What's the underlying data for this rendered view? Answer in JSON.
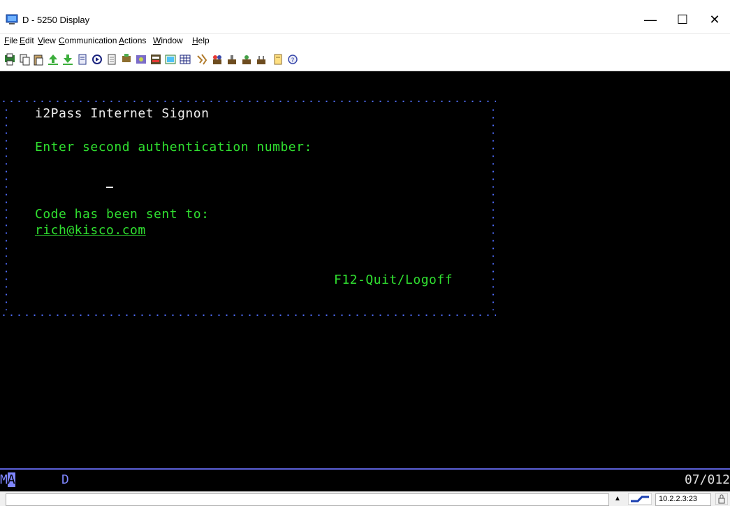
{
  "window": {
    "title": "D - 5250 Display",
    "controls": {
      "minimize": "—",
      "maximize": "☐",
      "close": "✕"
    }
  },
  "menu": {
    "items": [
      {
        "label": "File",
        "accel": "F",
        "rest": "ile"
      },
      {
        "label": "Edit",
        "accel": "E",
        "rest": "dit"
      },
      {
        "label": "View",
        "accel": "V",
        "rest": "iew"
      },
      {
        "label": "Communication",
        "accel": "C",
        "rest": "ommunication"
      },
      {
        "label": "Actions",
        "accel": "A",
        "rest": "ctions"
      },
      {
        "label": "Window",
        "accel": "W",
        "rest": "indow"
      },
      {
        "label": "Help",
        "accel": "H",
        "rest": "elp"
      }
    ]
  },
  "toolbar": {
    "icons": [
      "print-screen-icon",
      "copy-icon",
      "paste-icon",
      "send-file-icon",
      "receive-file-icon",
      "macro-icon",
      "record-icon",
      "playback-icon",
      "display-icon",
      "keyboard-icon",
      "sql-icon",
      "image-icon",
      "grid-icon",
      "data-transfer-icon",
      "session-a-icon",
      "session-b-icon",
      "session-c-icon",
      "session-d-icon",
      "notes-icon",
      "help-icon"
    ]
  },
  "terminal": {
    "heading": "i2Pass Internet Signon",
    "prompt": "Enter second authentication number:",
    "sent_to_label": "Code has been sent to:",
    "email": "rich@kisco.com",
    "fkey": "F12-Quit/Logoff",
    "colors": {
      "text_white": "#f0f0f0",
      "text_green": "#30e030",
      "border_blue": "#4f6cff"
    }
  },
  "status_line": {
    "mode": "MA",
    "session": "D",
    "cursor_pos": "07/012"
  },
  "bottom_bar": {
    "ip": "10.2.2.3:23"
  }
}
